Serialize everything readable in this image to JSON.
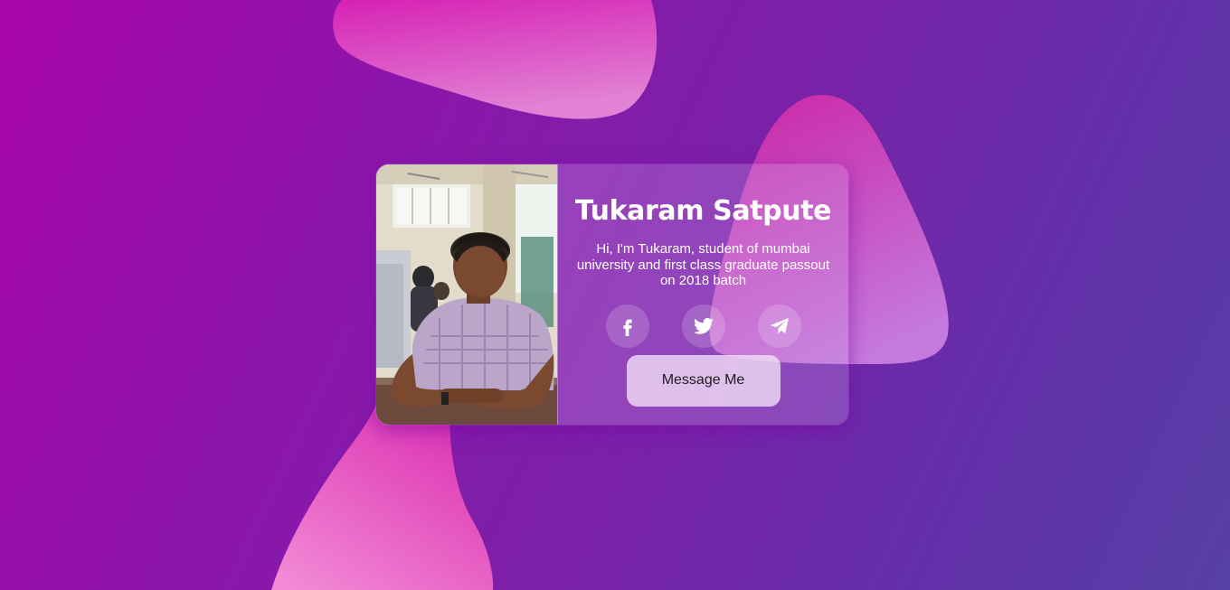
{
  "theme": {
    "background_start": "#a805a9",
    "background_end": "#5640a6",
    "blob_pink": "#e04bc4",
    "card_glass": "rgba(210,160,235,0.28)"
  },
  "profile": {
    "name": "Tukaram Satpute",
    "bio": "Hi, I'm Tukaram, student of mumbai university and first class graduate passout on 2018 batch",
    "photo_alt": "profile-photo"
  },
  "socials": [
    {
      "icon": "facebook-icon"
    },
    {
      "icon": "twitter-icon"
    },
    {
      "icon": "telegram-icon"
    }
  ],
  "actions": {
    "message_label": "Message Me"
  }
}
